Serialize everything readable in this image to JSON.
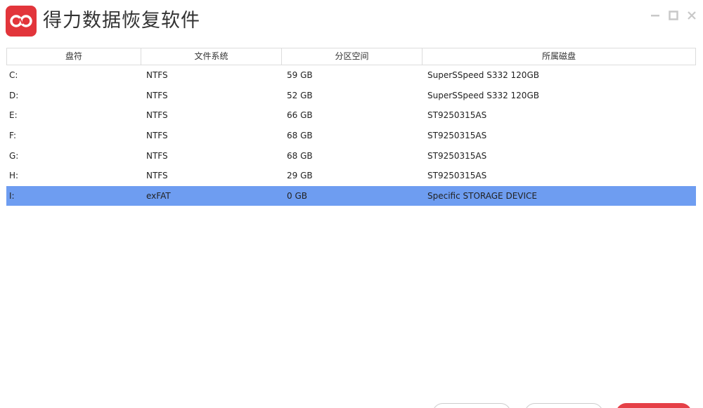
{
  "app": {
    "title": "得力数据恢复软件",
    "brand_color": "#e2353b",
    "selection_color": "#6e9df1"
  },
  "window_controls": {
    "minimize_icon": "minimize-icon",
    "maximize_icon": "maximize-icon",
    "close_icon": "close-icon"
  },
  "table": {
    "columns": [
      "盘符",
      "文件系统",
      "分区空间",
      "所属磁盘"
    ],
    "rows": [
      {
        "drive": "C:",
        "fs": "NTFS",
        "size": "59 GB",
        "disk": "SuperSSpeed S332 120GB"
      },
      {
        "drive": "D:",
        "fs": "NTFS",
        "size": "52 GB",
        "disk": "SuperSSpeed S332 120GB"
      },
      {
        "drive": "E:",
        "fs": "NTFS",
        "size": "66 GB",
        "disk": "ST9250315AS"
      },
      {
        "drive": "F:",
        "fs": "NTFS",
        "size": "68 GB",
        "disk": "ST9250315AS"
      },
      {
        "drive": "G:",
        "fs": "NTFS",
        "size": "68 GB",
        "disk": "ST9250315AS"
      },
      {
        "drive": "H:",
        "fs": "NTFS",
        "size": "29 GB",
        "disk": "ST9250315AS"
      },
      {
        "drive": "I:",
        "fs": "exFAT",
        "size": "0 GB",
        "disk": "Specific STORAGE DEVICE"
      }
    ],
    "selected_row": 6
  }
}
